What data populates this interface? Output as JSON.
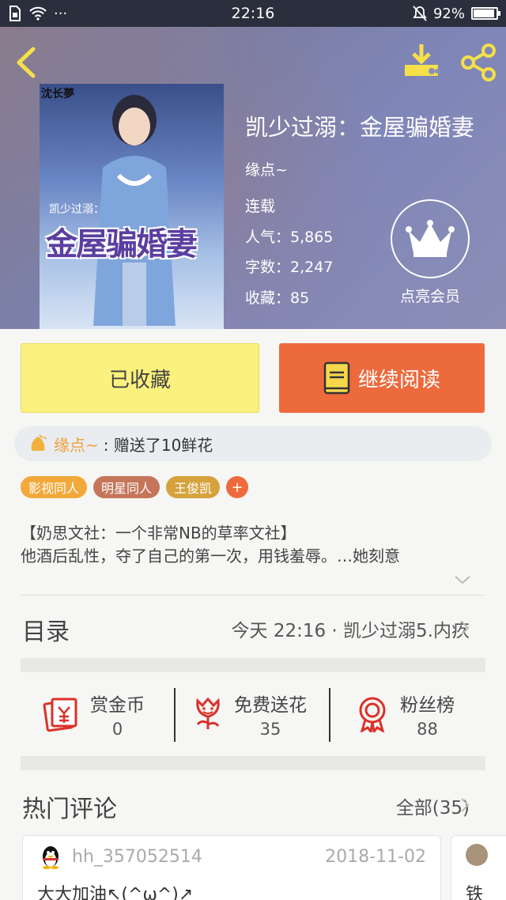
{
  "status_bar": {
    "time": "22:16",
    "dots": "···",
    "battery": "92%",
    "battery_level": 0.92
  },
  "header": {
    "back_icon": "chevron-left-icon",
    "download_icon": "download-icon",
    "share_icon": "share-icon"
  },
  "book": {
    "title": "凯少过溺：金屋骗婚妻",
    "author": "缘点~",
    "status": "连载",
    "popularity": "人气：5,865",
    "word_count": "字数：2,247",
    "favorites": "收藏：85",
    "cover": {
      "small_text": "凯少过溺：",
      "big_title": "金屋骗婚妻",
      "watermark": "沈长夢"
    }
  },
  "member": {
    "label": "点亮会员",
    "icon": "crown-icon"
  },
  "actions": {
    "collected_label": "已收藏",
    "read_label": "继续阅读"
  },
  "gift": {
    "user": "缘点~",
    "text": ": 赠送了10鲜花"
  },
  "tags": [
    {
      "label": "影视同人",
      "color": "#f2a93b"
    },
    {
      "label": "明星同人",
      "color": "#c5765a"
    },
    {
      "label": "王俊凯",
      "color": "#d6a23c"
    }
  ],
  "tag_add": "+",
  "synopsis": {
    "line1": "【奶思文社：一个非常NB的草率文社】",
    "line2": "他酒后乱性，夺了自己的第一次，用钱羞辱。…她刻意"
  },
  "toc": {
    "label": "目录",
    "latest": "今天 22:16 · 凯少过溺5.内疚"
  },
  "stats": [
    {
      "label": "赏金币",
      "value": "0",
      "icon": "red-envelope-icon"
    },
    {
      "label": "免费送花",
      "value": "35",
      "icon": "flower-icon"
    },
    {
      "label": "粉丝榜",
      "value": "88",
      "icon": "medal-icon"
    }
  ],
  "comments": {
    "label": "热门评论",
    "all_label": "全部(35)",
    "items": [
      {
        "user": "hh_357052514",
        "date": "2018-11-02",
        "text": "大大加油↖(^ω^)↗"
      },
      {
        "text": "铁"
      }
    ]
  }
}
